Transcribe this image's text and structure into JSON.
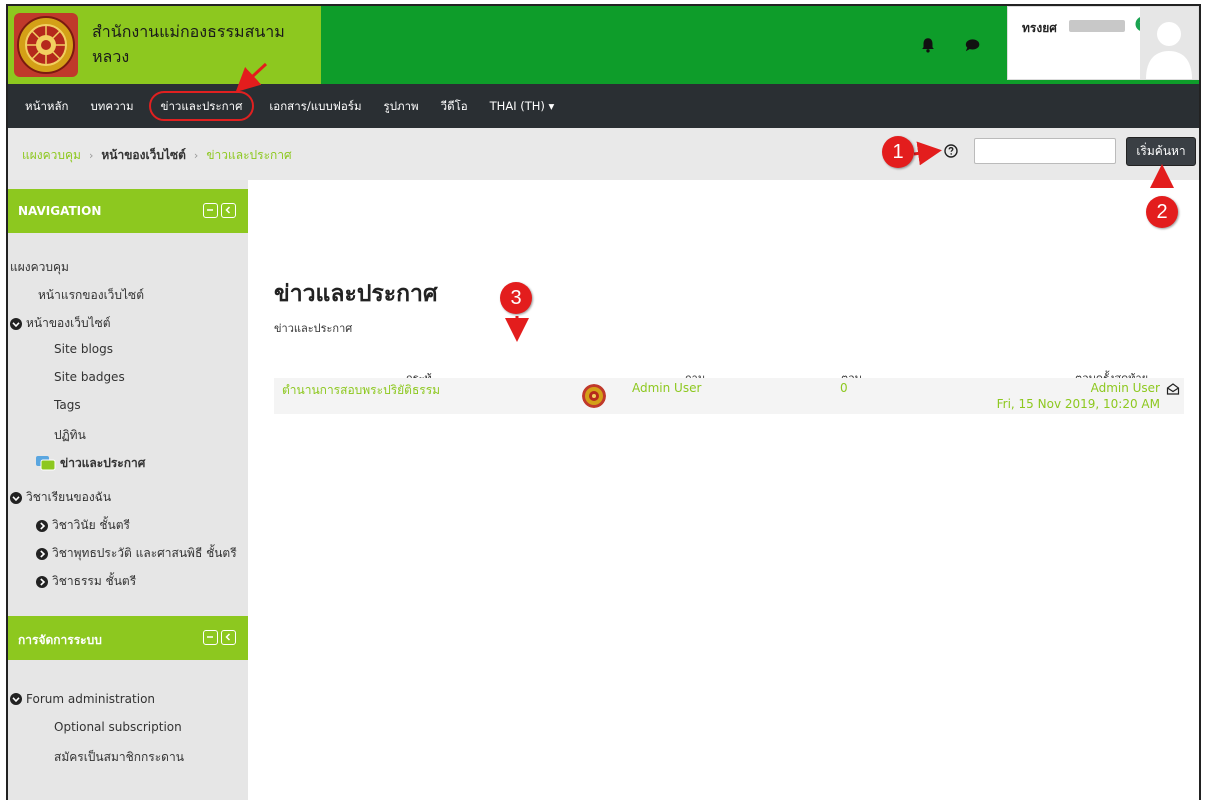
{
  "header": {
    "site_title": "สำนักงานแม่กองธรรมสนามหลวง",
    "username": "ทรงยศ",
    "brand_color": "#8dc81f",
    "header_color": "#0e9d2a",
    "icons": [
      "bell-icon",
      "chat-icon",
      "online-status-icon"
    ]
  },
  "topnav": {
    "items": [
      {
        "label": "หน้าหลัก"
      },
      {
        "label": "บทความ"
      },
      {
        "label": "ข่าวและประกาศ"
      },
      {
        "label": "เอกสาร/แบบฟอร์ม"
      },
      {
        "label": "รูปภาพ"
      },
      {
        "label": "วีดีโอ"
      },
      {
        "label": "THAI (TH) ▾"
      }
    ]
  },
  "breadcrumb": {
    "items": [
      "แผงควบคุม",
      "หน้าของเว็บไซต์",
      "ข่าวและประกาศ"
    ],
    "separator": "›"
  },
  "search": {
    "value": "",
    "button_label": "เริ่มค้นหา"
  },
  "sidebar": {
    "navigation": {
      "title": "NAVIGATION",
      "items": [
        {
          "label": "แผงควบคุม"
        },
        {
          "label": "หน้าแรกของเว็บไซต์"
        },
        {
          "label": "หน้าของเว็บไซต์"
        },
        {
          "label": "Site blogs"
        },
        {
          "label": "Site badges"
        },
        {
          "label": "Tags"
        },
        {
          "label": "ปฏิทิน"
        },
        {
          "label": "ข่าวและประกาศ"
        },
        {
          "label": "วิชาเรียนของฉัน"
        },
        {
          "label": "วิชาวินัย ชั้นตรี"
        },
        {
          "label": "วิชาพุทธประวัติ และศาสนพิธี ชั้นตรี"
        },
        {
          "label": "วิชาธรรม ชั้นตรี"
        }
      ]
    },
    "admin": {
      "title": "การจัดการระบบ",
      "items": [
        {
          "label": "Forum administration"
        },
        {
          "label": "Optional subscription"
        },
        {
          "label": "สมัครเป็นสมาชิกกระดาน"
        }
      ]
    }
  },
  "main": {
    "title": "ข่าวและประกาศ",
    "subtitle": "ข่าวและประกาศ",
    "table": {
      "headers": [
        "กระทู้",
        "ถาม",
        "ตอบ",
        "ตอบครั้งสุดท้าย"
      ],
      "rows": [
        {
          "topic": "ตำนานการสอบพระปริยัติธรรม",
          "author": "Admin User",
          "replies": "0",
          "last_by": "Admin User",
          "last_date": "Fri, 15 Nov 2019, 10:20 AM"
        }
      ]
    }
  },
  "annotations": {
    "markers": [
      "1",
      "2",
      "3"
    ],
    "color": "#e31d1d"
  }
}
